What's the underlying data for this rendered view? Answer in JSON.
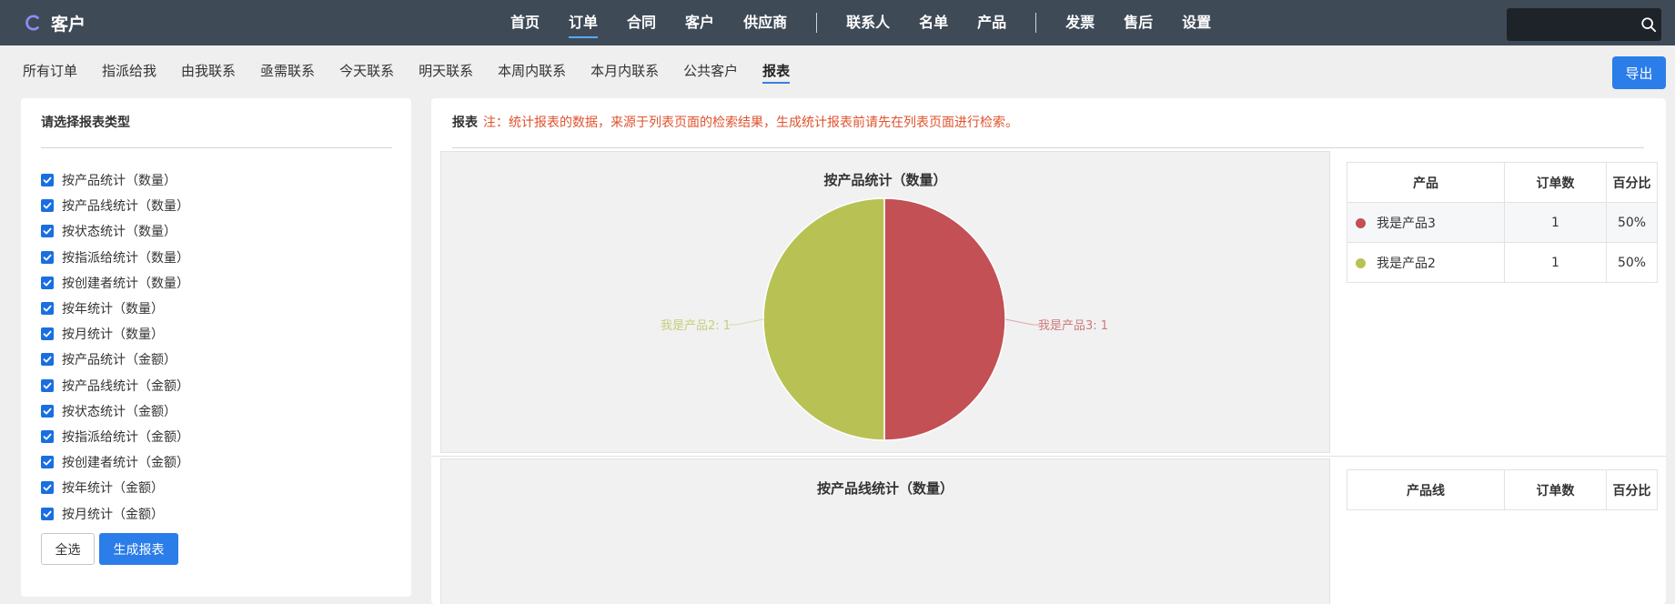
{
  "brand": {
    "title": "客户"
  },
  "nav": {
    "items": [
      {
        "label": "首页",
        "active": false
      },
      {
        "label": "订单",
        "active": true
      },
      {
        "label": "合同",
        "active": false
      },
      {
        "label": "客户",
        "active": false
      },
      {
        "label": "供应商",
        "active": false
      },
      {
        "label": "联系人",
        "active": false
      },
      {
        "label": "名单",
        "active": false
      },
      {
        "label": "产品",
        "active": false
      },
      {
        "label": "发票",
        "active": false
      },
      {
        "label": "售后",
        "active": false
      },
      {
        "label": "设置",
        "active": false
      }
    ]
  },
  "subtabs": {
    "items": [
      {
        "label": "所有订单"
      },
      {
        "label": "指派给我"
      },
      {
        "label": "由我联系"
      },
      {
        "label": "亟需联系"
      },
      {
        "label": "今天联系"
      },
      {
        "label": "明天联系"
      },
      {
        "label": "本周内联系"
      },
      {
        "label": "本月内联系"
      },
      {
        "label": "公共客户"
      },
      {
        "label": "报表"
      }
    ],
    "export_label": "导出"
  },
  "left_panel": {
    "title": "请选择报表类型",
    "options": [
      {
        "label": "按产品统计（数量）",
        "checked": true
      },
      {
        "label": "按产品线统计（数量）",
        "checked": true
      },
      {
        "label": "按状态统计（数量）",
        "checked": true
      },
      {
        "label": "按指派给统计（数量）",
        "checked": true
      },
      {
        "label": "按创建者统计（数量）",
        "checked": true
      },
      {
        "label": "按年统计（数量）",
        "checked": true
      },
      {
        "label": "按月统计（数量）",
        "checked": true
      },
      {
        "label": "按产品统计（金额）",
        "checked": true
      },
      {
        "label": "按产品线统计（金额）",
        "checked": true
      },
      {
        "label": "按状态统计（金额）",
        "checked": true
      },
      {
        "label": "按指派给统计（金额）",
        "checked": true
      },
      {
        "label": "按创建者统计（金额）",
        "checked": true
      },
      {
        "label": "按年统计（金额）",
        "checked": true
      },
      {
        "label": "按月统计（金额）",
        "checked": true
      }
    ],
    "select_all_label": "全选",
    "generate_label": "生成报表"
  },
  "report": {
    "label": "报表",
    "note": "注：统计报表的数据，来源于列表页面的检索结果，生成统计报表前请先在列表页面进行检索。",
    "table1": {
      "headers": [
        "产品",
        "订单数",
        "百分比"
      ],
      "rows": [
        {
          "name": "我是产品3",
          "count": "1",
          "percent": "50%",
          "color": "#c25055"
        },
        {
          "name": "我是产品2",
          "count": "1",
          "percent": "50%",
          "color": "#b8c254"
        }
      ]
    },
    "table2": {
      "headers": [
        "产品线",
        "订单数",
        "百分比"
      ]
    }
  },
  "chart_data": [
    {
      "type": "pie",
      "title": "按产品统计（数量）",
      "categories": [
        "我是产品3",
        "我是产品2"
      ],
      "values": [
        1,
        1
      ],
      "colors": [
        "#c25055",
        "#b8c254"
      ],
      "slice_labels": [
        "我是产品3: 1",
        "我是产品2: 1"
      ]
    },
    {
      "type": "pie",
      "title": "按产品线统计（数量）",
      "categories": [],
      "values": []
    }
  ]
}
